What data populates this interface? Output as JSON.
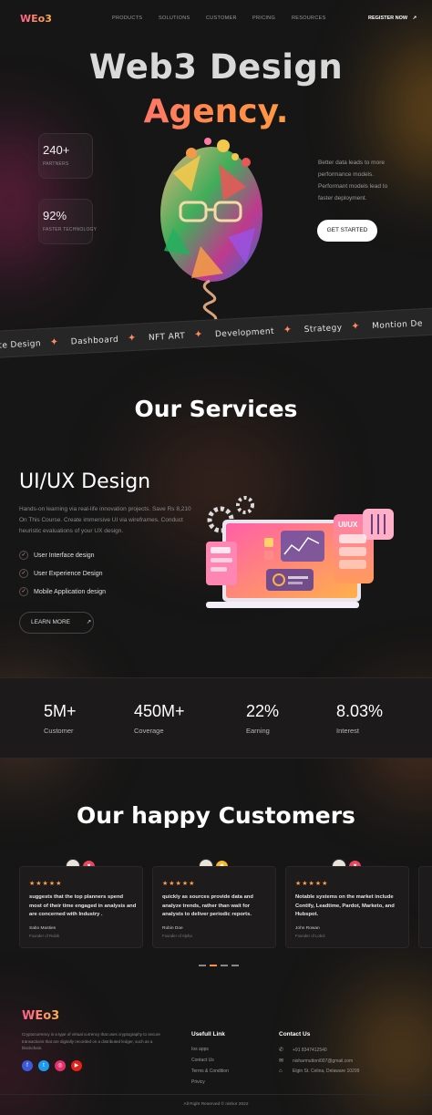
{
  "brand": {
    "logo": "WEo3"
  },
  "nav": {
    "links": [
      "PRODUCTS",
      "SOLUTIONS",
      "CUSTOMER",
      "PRICING",
      "RESOURCES"
    ],
    "register": "REGISTER NOW",
    "register_icon": "arrow-up-right-icon"
  },
  "hero": {
    "title_line1": "Web3 Design",
    "title_line2": "Agency.",
    "stats": [
      {
        "value": "240+",
        "label": "PARTNERS"
      },
      {
        "value": "92%",
        "label": "FASTER TECHNOLOGY"
      }
    ],
    "description": "Better data leads to more performance models. Performant models lead to faster deployment.",
    "cta": "GET STARTED"
  },
  "marquee": {
    "items": [
      "site Design",
      "Dashboard",
      "NFT ART",
      "Development",
      "Strategy",
      "Montion De"
    ],
    "separator_icon": "sparkle-icon"
  },
  "services": {
    "section_title": "Our Services",
    "title": "UI/UX Design",
    "description": "Hands-on learning via real-life innovation projects. Save Rs 8,210 On This Course. Create immersive UI via wireframes. Conduct heuristic evaluations of your UX design.",
    "features": [
      "User Interface design",
      "User Experience Design",
      "Mobile Application design"
    ],
    "learn_more": "LEARN MORE",
    "illustration_label": "UI/UX"
  },
  "stats_band": [
    {
      "value": "5M+",
      "label": "Customer"
    },
    {
      "value": "450M+",
      "label": "Coverage"
    },
    {
      "value": "22%",
      "label": "Earning"
    },
    {
      "value": "8.03%",
      "label": "Interest"
    }
  ],
  "testimonials": {
    "section_title": "Our happy Customers",
    "rating_stars": "★★★★★",
    "cards": [
      {
        "text": "suggests that the top planners spend most of their time engaged in analysis and are concerned with Industry .",
        "name": "Sabo Masties",
        "role": "Founder of Rubik"
      },
      {
        "text": "quickly as sources provide data and analyze trends, rather than wait for analysts to deliver periodic reports.",
        "name": "Robin Doe",
        "role": "Founder of Alpha"
      },
      {
        "text": "Notable systems on the market include Contify, Leadtime, Pardot, Marketo, and Hubspot.",
        "name": "John Rowan",
        "role": "Founder of Lobol"
      }
    ]
  },
  "footer": {
    "logo": "WEo3",
    "description": "Cryptocurrency is a type of virtual currency that uses cryptography to secure transactions that are digitally recorded on a distributed ledger, such as a blockchain.",
    "socials": [
      "facebook-icon",
      "twitter-icon",
      "instagram-icon",
      "youtube-icon"
    ],
    "links_heading": "Usefull Link",
    "links": [
      "Ios apps",
      "Contact Us",
      "Terms & Condition",
      "Privicy"
    ],
    "contact_heading": "Contact Us",
    "contacts": [
      {
        "icon": "phone-icon",
        "text": "+91 8347412540"
      },
      {
        "icon": "mail-icon",
        "text": "nisharmuttoni007@gmail.com"
      },
      {
        "icon": "map-icon",
        "text": "Elgin St. Celina, Delaware 10299"
      }
    ],
    "copyright": "All Right Reserved © nishor 2022"
  },
  "colors": {
    "accent_pink": "#ff4fa3",
    "accent_orange": "#ff8a4a",
    "background": "#161616"
  }
}
